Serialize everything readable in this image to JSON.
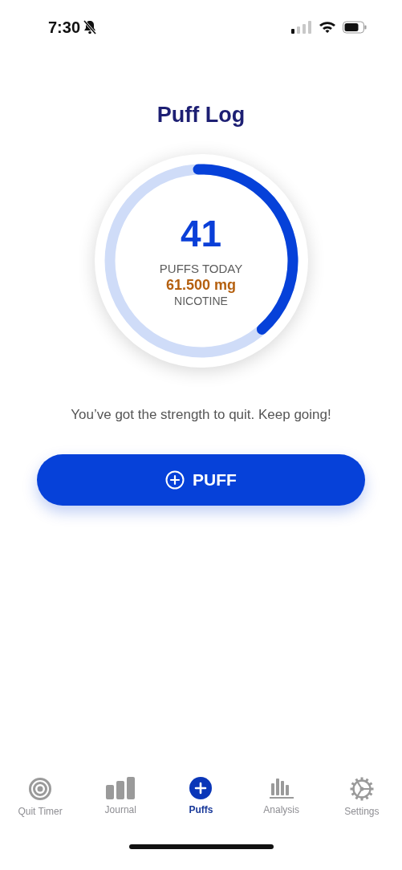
{
  "status_bar": {
    "time": "7:30",
    "muted": true
  },
  "title": "Puff Log",
  "progress": {
    "level": 0.39,
    "count": "41",
    "count_label": "PUFFS TODAY",
    "amount": "61.500 mg",
    "amount_label": "NICOTINE"
  },
  "message": "You’ve got the strength to quit. Keep going!",
  "puff_button": {
    "label": "PUFF"
  },
  "tabs": [
    {
      "kind": "target",
      "label": "Quit Timer",
      "selected": false
    },
    {
      "kind": "bars",
      "label": "Journal",
      "selected": false
    },
    {
      "kind": "plus",
      "label": "Puffs",
      "selected": true
    },
    {
      "kind": "chart",
      "label": "Analysis",
      "selected": false
    },
    {
      "kind": "gear",
      "label": "Settings",
      "selected": false
    }
  ]
}
